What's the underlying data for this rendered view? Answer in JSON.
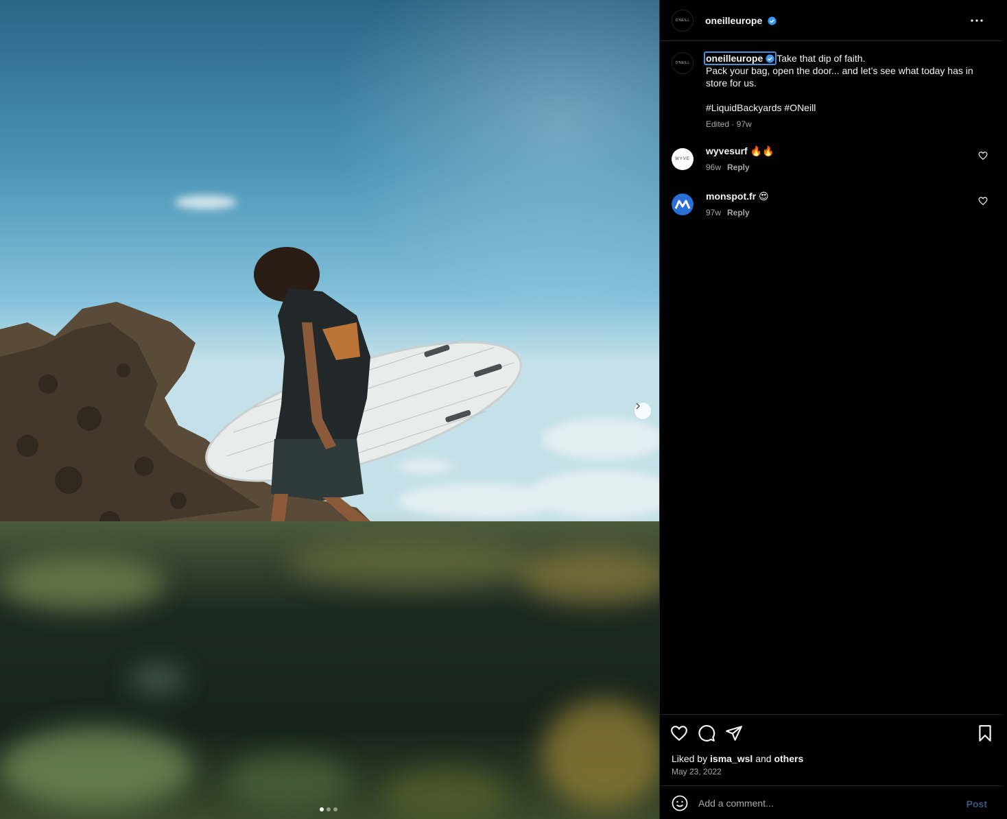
{
  "post": {
    "username": "oneilleurope",
    "avatar_text": "O'NEILL",
    "caption_line1": "Take that dip of faith.",
    "caption_line2": "Pack your bag, open the door... and let’s see what today has in store for us.",
    "hashtags": "#LiquidBackyards #ONeill",
    "meta": "Edited · 97w"
  },
  "comments": [
    {
      "username": "wyvesurf",
      "text": "🔥🔥",
      "age": "96w",
      "reply": "Reply",
      "avatar_text": "WYVE"
    },
    {
      "username": "monspot.fr",
      "text": "😍",
      "age": "97w",
      "reply": "Reply"
    }
  ],
  "likes": {
    "prefix": "Liked by",
    "user": "isma_wsl",
    "conj": "and",
    "others": "others"
  },
  "date": "May 23, 2022",
  "comment_box": {
    "placeholder": "Add a comment...",
    "post_label": "Post"
  },
  "carousel": {
    "count": 3,
    "active": 0
  },
  "colors": {
    "verified": "#3897f0",
    "post_disabled": "#3a5a80",
    "bg": "#000000"
  }
}
